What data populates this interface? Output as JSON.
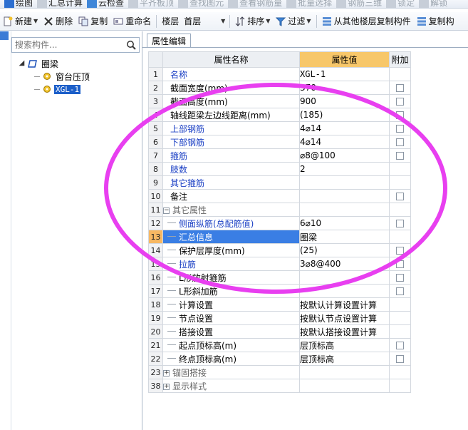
{
  "toolbar_top": {
    "items": [
      "绘图",
      "汇总计算",
      "云检查",
      "平齐板顶",
      "查找图元",
      "查看钢筋量",
      "批量选择",
      "钢筋三维",
      "锁定",
      "解锁"
    ]
  },
  "toolbar": {
    "new_label": "新建",
    "delete_label": "删除",
    "copy_label": "复制",
    "rename_label": "重命名",
    "floor_label": "楼层",
    "floor_value": "首层",
    "sort_label": "排序",
    "filter_label": "过滤",
    "copy_from_floor_label": "从其他楼层复制构件",
    "copy_to_label": "复制构"
  },
  "left_panel": {
    "search_placeholder": "搜索构件...",
    "tree": {
      "root": "圈梁",
      "children": [
        "窗台压顶",
        "XGL-1"
      ]
    }
  },
  "right_panel": {
    "tab_label": "属性编辑",
    "columns": {
      "name": "属性名称",
      "value": "属性值",
      "extra": "附加"
    },
    "rows": [
      {
        "num": "1",
        "name": "名称",
        "value": "XGL-1",
        "style": "blue",
        "checkbox": false
      },
      {
        "num": "2",
        "name": "截面宽度(mm)",
        "value": "370",
        "style": "black",
        "checkbox": true
      },
      {
        "num": "3",
        "name": "截面高度(mm)",
        "value": "900",
        "style": "black",
        "checkbox": true
      },
      {
        "num": "4",
        "name": "轴线距梁左边线距离(mm)",
        "value": "(185)",
        "style": "black",
        "checkbox": true
      },
      {
        "num": "5",
        "name": "上部钢筋",
        "value": "4⌀14",
        "style": "blue",
        "checkbox": true
      },
      {
        "num": "6",
        "name": "下部钢筋",
        "value": "4⌀14",
        "style": "blue",
        "checkbox": true
      },
      {
        "num": "7",
        "name": "箍筋",
        "value": "⌀8@100",
        "style": "blue",
        "checkbox": true
      },
      {
        "num": "8",
        "name": "肢数",
        "value": "2",
        "style": "blue",
        "checkbox": false
      },
      {
        "num": "9",
        "name": "其它箍筋",
        "value": "",
        "style": "blue",
        "checkbox": false
      },
      {
        "num": "10",
        "name": "备注",
        "value": "",
        "style": "black",
        "checkbox": true
      },
      {
        "num": "11",
        "name": "其它属性",
        "value": "",
        "style": "group",
        "checkbox": false,
        "toggle": "−"
      },
      {
        "num": "12",
        "name": "侧面纵筋(总配筋值)",
        "value": "6⌀10",
        "style": "blue-child",
        "checkbox": true
      },
      {
        "num": "13",
        "name": "汇总信息",
        "value": "圈梁",
        "style": "hl-child",
        "checkbox": false
      },
      {
        "num": "14",
        "name": "保护层厚度(mm)",
        "value": "(25)",
        "style": "child",
        "checkbox": true
      },
      {
        "num": "15",
        "name": "拉筋",
        "value": "3⌀8@400",
        "style": "blue-child",
        "checkbox": true
      },
      {
        "num": "16",
        "name": "L形放射箍筋",
        "value": "",
        "style": "child",
        "checkbox": true
      },
      {
        "num": "17",
        "name": "L形斜加筋",
        "value": "",
        "style": "child",
        "checkbox": true
      },
      {
        "num": "18",
        "name": "计算设置",
        "value": "按默认计算设置计算",
        "style": "child",
        "checkbox": false
      },
      {
        "num": "19",
        "name": "节点设置",
        "value": "按默认节点设置计算",
        "style": "child",
        "checkbox": false
      },
      {
        "num": "20",
        "name": "搭接设置",
        "value": "按默认搭接设置计算",
        "style": "child",
        "checkbox": false
      },
      {
        "num": "21",
        "name": "起点顶标高(m)",
        "value": "层顶标高",
        "style": "child",
        "checkbox": true
      },
      {
        "num": "22",
        "name": "终点顶标高(m)",
        "value": "层顶标高",
        "style": "child",
        "checkbox": true
      },
      {
        "num": "23",
        "name": "锚固搭接",
        "value": "",
        "style": "group",
        "checkbox": false,
        "toggle": "+"
      },
      {
        "num": "38",
        "name": "显示样式",
        "value": "",
        "style": "group",
        "checkbox": false,
        "toggle": "+"
      }
    ]
  },
  "colors": {
    "accent_blue": "#1a3fc4",
    "selection": "#3a7ee4",
    "value_header": "#f7c76a",
    "annotation_circle": "#e83ff0"
  }
}
